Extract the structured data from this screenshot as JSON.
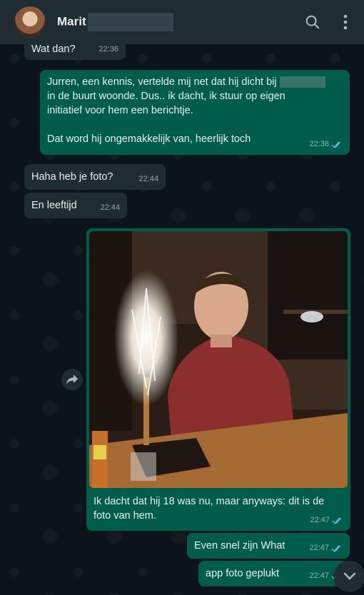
{
  "header": {
    "contact_name": "Marit",
    "icons": [
      "search-icon",
      "more-vertical-icon"
    ]
  },
  "messages": [
    {
      "dir": "in",
      "text": "Wat dan?",
      "time": "22:36"
    },
    {
      "dir": "out",
      "text_line1_a": "Jurren, een kennis, vertelde mij net dat hij dicht bij",
      "text_rest": "in de buurt woonde. Dus.. ik dacht, ik stuur op eigen\ninitiatief voor hem een berichtje.\n\nDat word hij ongemakkelijk van, heerlijk toch",
      "time": "22:38",
      "read": true
    },
    {
      "dir": "in",
      "text": "Haha heb je foto?",
      "time": "22:44"
    },
    {
      "dir": "in",
      "text": "En leeftijd",
      "time": "22:44"
    },
    {
      "dir": "out",
      "type": "image",
      "caption": "Ik dacht dat hij 18 was nu, maar anyways: dit is de\nfoto van hem.",
      "time": "22:47",
      "read": true
    },
    {
      "dir": "out",
      "text": "Even snel zijn What",
      "time": "22:47",
      "read": true
    },
    {
      "dir": "out",
      "text": "app foto geplukt",
      "time": "22:47",
      "read": true
    }
  ],
  "colors": {
    "incoming": "#202c33",
    "outgoing": "#005c4b",
    "read_tick": "#53bdeb",
    "background": "#0b141a"
  }
}
